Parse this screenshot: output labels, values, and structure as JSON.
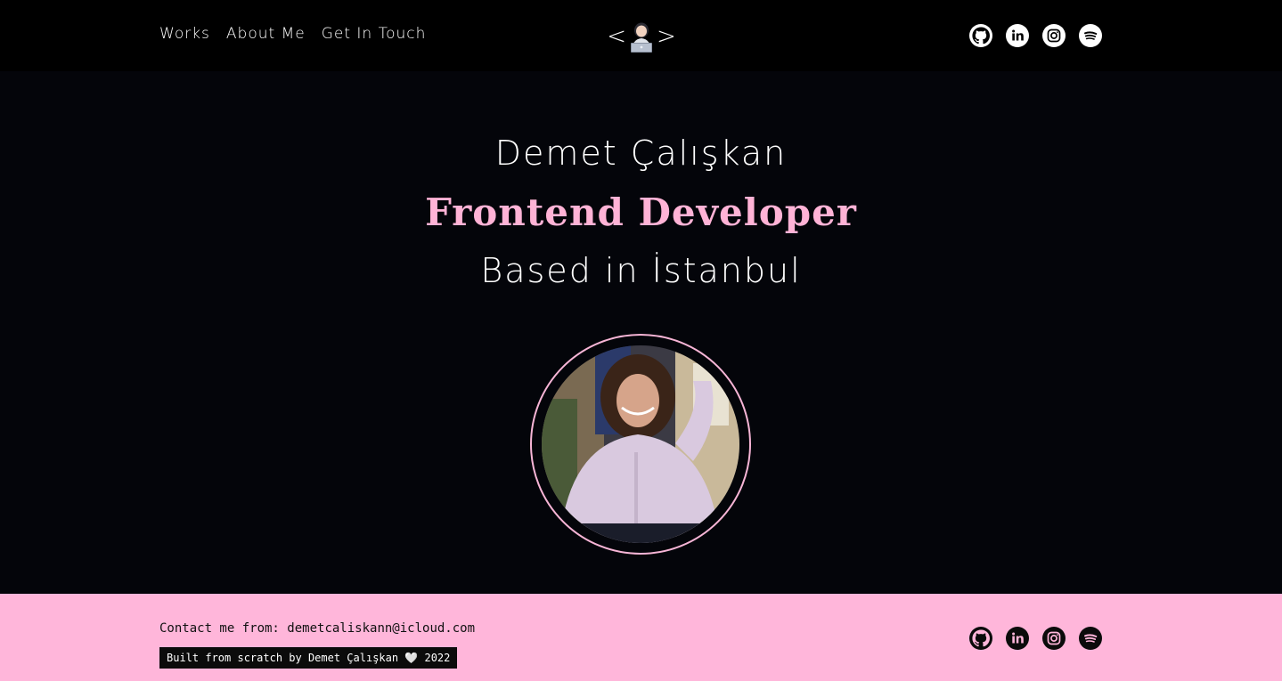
{
  "nav": {
    "items": [
      {
        "label": "Works"
      },
      {
        "label": "About Me"
      },
      {
        "label": "Get In Touch"
      }
    ]
  },
  "logo": {
    "left_bracket": "<",
    "right_bracket": ">",
    "icon": "technologist-emoji-icon"
  },
  "social": {
    "icons": [
      "github-icon",
      "linkedin-icon",
      "instagram-icon",
      "spotify-icon"
    ]
  },
  "hero": {
    "name": "Demet Çalışkan",
    "role": "Frontend Developer",
    "location": "Based in İstanbul"
  },
  "footer": {
    "contact_prefix": "Contact me from: ",
    "email": "demetcaliskann@icloud.com",
    "credit": "Built from scratch by Demet Çalışkan 🤍 2022"
  },
  "colors": {
    "background": "#04050a",
    "accent_pink": "#ffb3d6",
    "footer_pink": "#ffb6da",
    "text": "#ffffff"
  }
}
